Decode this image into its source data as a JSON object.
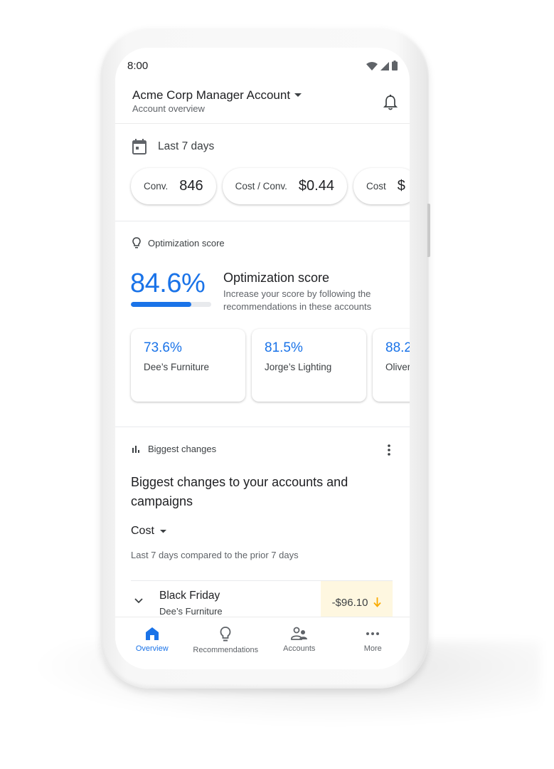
{
  "status_bar": {
    "time": "8:00",
    "icons": [
      "wifi-icon",
      "signal-icon",
      "battery-icon"
    ]
  },
  "header": {
    "account_name": "Acme Corp Manager Account",
    "subtitle": "Account overview"
  },
  "date_range": {
    "label": "Last 7 days"
  },
  "metrics": [
    {
      "label": "Conv.",
      "value": "846"
    },
    {
      "label": "Cost / Conv.",
      "value": "$0.44"
    },
    {
      "label": "Cost",
      "value": "$"
    }
  ],
  "optimization": {
    "section_label": "Optimization score",
    "score": "84.6%",
    "score_fraction": 0.75,
    "title": "Optimization score",
    "description": "Increase your score by following the recommendations in these accounts",
    "accounts": [
      {
        "score": "73.6%",
        "name": "Dee’s Furniture"
      },
      {
        "score": "81.5%",
        "name": "Jorge’s Lighting"
      },
      {
        "score": "88.2",
        "name": "Oliver"
      }
    ]
  },
  "biggest_changes": {
    "section_label": "Biggest changes",
    "title": "Biggest changes to your accounts and campaigns",
    "metric": "Cost",
    "compare_text": "Last 7 days compared to the prior 7 days",
    "rows": [
      {
        "title": "Black Friday",
        "subtitle": "Dee’s Furniture",
        "delta": "-$96.10",
        "direction": "down"
      }
    ]
  },
  "bottom_nav": [
    {
      "label": "Overview",
      "icon": "home-icon",
      "active": true
    },
    {
      "label": "Recommendations",
      "icon": "lightbulb-icon",
      "active": false
    },
    {
      "label": "Accounts",
      "icon": "accounts-icon",
      "active": false
    },
    {
      "label": "More",
      "icon": "more-horiz-icon",
      "active": false
    }
  ],
  "colors": {
    "accent": "#1a73e8",
    "delta_bg": "#fef7e0",
    "delta_arrow": "#f9ab00"
  }
}
